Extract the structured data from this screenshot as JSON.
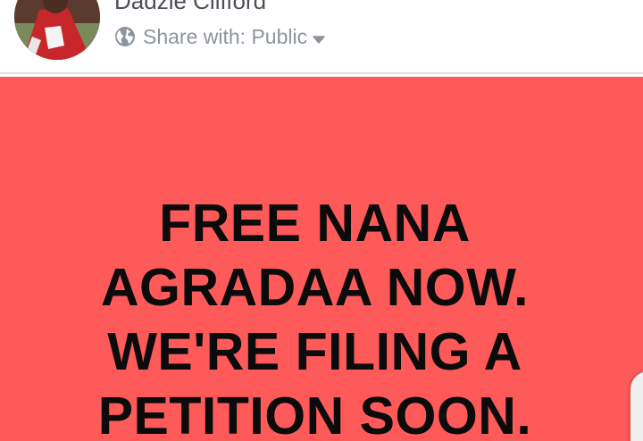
{
  "composer": {
    "author_name": "Dadzie Clifford",
    "share_label": "Share with: Public",
    "icons": {
      "privacy": "globe-icon",
      "dropdown": "caret-down-icon"
    }
  },
  "post": {
    "background_color": "#ff5a5a",
    "lines": [
      "FREE NANA",
      "AGRADAA NOW.",
      "WE'RE FILING A",
      "PETITION SOON."
    ]
  }
}
